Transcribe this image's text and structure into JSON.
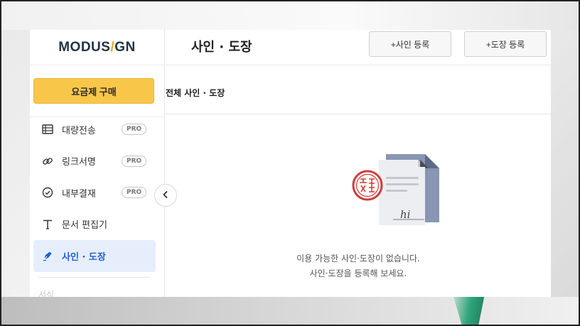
{
  "app": {
    "logo_left": "MODUS",
    "logo_slash": "/",
    "logo_right": "GN"
  },
  "sidebar": {
    "plan_button": "요금제 구매",
    "items": [
      {
        "label": "대량전송",
        "badge": "PRO",
        "icon": "table-icon"
      },
      {
        "label": "링크서명",
        "badge": "PRO",
        "icon": "link-icon"
      },
      {
        "label": "내부결재",
        "badge": "PRO",
        "icon": "check-circle-icon"
      },
      {
        "label": "문서 편집기",
        "badge": "",
        "icon": "text-t-icon"
      },
      {
        "label": "사인 · 도장",
        "badge": "",
        "icon": "pen-nib-icon"
      }
    ],
    "cut_off_label": "서식"
  },
  "header": {
    "title": "사인 · 도장",
    "add_signature": "+사인 등록",
    "add_stamp": "+도장 등록"
  },
  "content": {
    "section_title": "전체 사인 · 도장",
    "empty_line1": "이용 가능한 사인·도장이 없습니다.",
    "empty_line2": "사인·도장을 등록해 보세요.",
    "illustration_signature": "hi"
  },
  "colors": {
    "accent_yellow": "#f8c74a",
    "active_blue": "#1f5fd6",
    "active_bg": "#e6eefc",
    "stamp_red": "#d23b3b",
    "logo_navy": "#233345",
    "logo_orange": "#f2a51a"
  }
}
